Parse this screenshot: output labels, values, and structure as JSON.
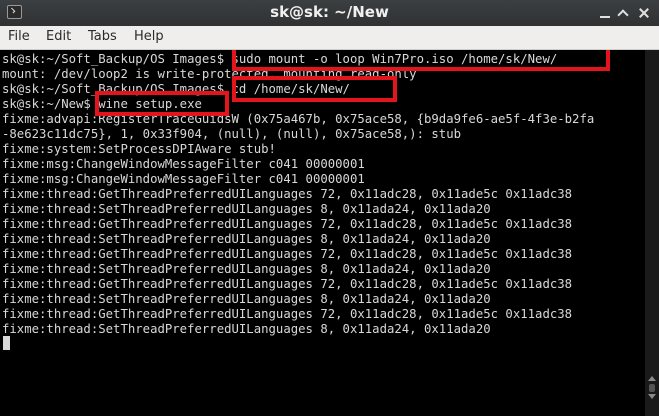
{
  "window": {
    "title": "sk@sk: ~/New"
  },
  "menu": {
    "items": [
      "File",
      "Edit",
      "Tabs",
      "Help"
    ]
  },
  "terminal": {
    "lines": [
      "sk@sk:~/Soft_Backup/OS Images$ sudo mount -o loop Win7Pro.iso /home/sk/New/",
      "mount: /dev/loop2 is write-protected, mounting read-only",
      "sk@sk:~/Soft_Backup/OS Images$ cd /home/sk/New/",
      "sk@sk:~/New$ wine setup.exe",
      "fixme:advapi:RegisterTraceGuidsW (0x75a467b, 0x75ace58, {b9da9fe6-ae5f-4f3e-b2fa",
      "-8e623c11dc75}, 1, 0x33f904, (null), (null), 0x75ace58,): stub",
      "fixme:system:SetProcessDPIAware stub!",
      "fixme:msg:ChangeWindowMessageFilter c041 00000001",
      "fixme:msg:ChangeWindowMessageFilter c041 00000001",
      "fixme:thread:GetThreadPreferredUILanguages 72, 0x11adc28, 0x11ade5c 0x11adc38",
      "fixme:thread:SetThreadPreferredUILanguages 8, 0x11ada24, 0x11ada20",
      "fixme:thread:GetThreadPreferredUILanguages 72, 0x11adc28, 0x11ade5c 0x11adc38",
      "fixme:thread:SetThreadPreferredUILanguages 8, 0x11ada24, 0x11ada20",
      "fixme:thread:GetThreadPreferredUILanguages 72, 0x11adc28, 0x11ade5c 0x11adc38",
      "fixme:thread:SetThreadPreferredUILanguages 8, 0x11ada24, 0x11ada20",
      "fixme:thread:GetThreadPreferredUILanguages 72, 0x11adc28, 0x11ade5c 0x11adc38",
      "fixme:thread:SetThreadPreferredUILanguages 8, 0x11ada24, 0x11ada20",
      "fixme:thread:GetThreadPreferredUILanguages 72, 0x11adc28, 0x11ade5c 0x11adc38",
      "fixme:thread:SetThreadPreferredUILanguages 8, 0x11ada24, 0x11ada20"
    ]
  },
  "colors": {
    "terminal_bg": "#000000",
    "terminal_fg": "#d8d8d8",
    "highlight": "#e3141b",
    "titlebar": "#353739",
    "menubar": "#efeeec"
  },
  "icons": {
    "app": "terminal-icon",
    "minimize": "minimize-icon",
    "maximize": "maximize-icon",
    "close": "close-icon"
  }
}
